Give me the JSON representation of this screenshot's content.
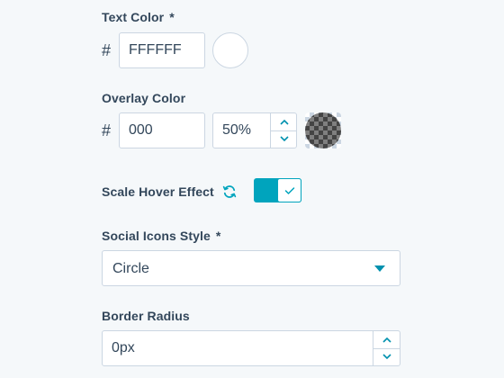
{
  "text_color": {
    "label": "Text Color",
    "required_mark": "*",
    "hash": "#",
    "value": "FFFFFF",
    "swatch_color": "#ffffff"
  },
  "overlay_color": {
    "label": "Overlay Color",
    "hash": "#",
    "value": "000",
    "opacity_value": "50%",
    "swatch_color": "#000000"
  },
  "scale_hover": {
    "label": "Scale Hover Effect",
    "icon": "sync-icon",
    "toggle_on": true,
    "accent_color": "#00a4bd"
  },
  "social_icons_style": {
    "label": "Social Icons Style",
    "required_mark": "*",
    "selected": "Circle"
  },
  "border_radius": {
    "label": "Border Radius",
    "value": "0px"
  }
}
